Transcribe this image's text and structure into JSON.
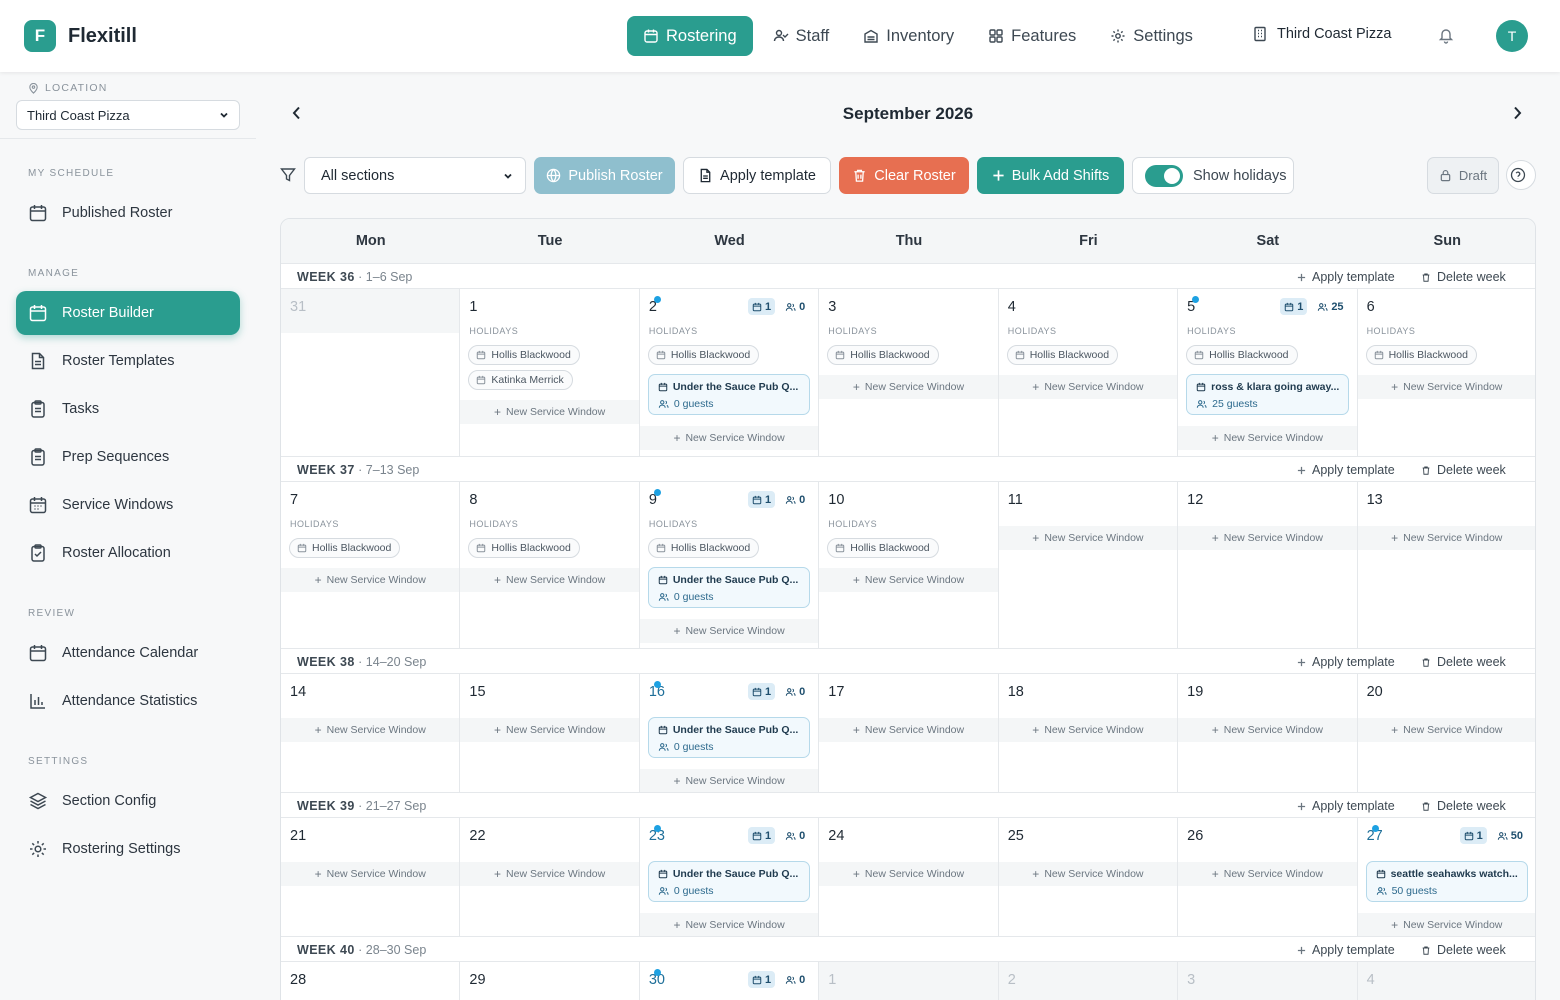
{
  "app": {
    "name": "Flexitill",
    "logo_letter": "F"
  },
  "nav": {
    "items": [
      {
        "label": "Rostering",
        "icon": "calendar-icon",
        "active": true
      },
      {
        "label": "Staff",
        "icon": "staff-icon"
      },
      {
        "label": "Inventory",
        "icon": "inventory-icon"
      },
      {
        "label": "Features",
        "icon": "grid-icon"
      },
      {
        "label": "Settings",
        "icon": "gear-icon"
      }
    ],
    "venue": "Third Coast Pizza",
    "avatar_letter": "T"
  },
  "sidebar": {
    "location_label": "LOCATION",
    "location_value": "Third Coast Pizza",
    "sections": [
      {
        "title": "MY SCHEDULE",
        "items": [
          {
            "label": "Published Roster",
            "icon": "calendar-icon"
          }
        ]
      },
      {
        "title": "MANAGE",
        "items": [
          {
            "label": "Roster Builder",
            "icon": "calendar-icon",
            "active": true
          },
          {
            "label": "Roster Templates",
            "icon": "document-icon"
          },
          {
            "label": "Tasks",
            "icon": "clipboard-icon"
          },
          {
            "label": "Prep Sequences",
            "icon": "clipboard-icon"
          },
          {
            "label": "Service Windows",
            "icon": "calendar-grid-icon"
          },
          {
            "label": "Roster Allocation",
            "icon": "clipboard-check-icon"
          }
        ]
      },
      {
        "title": "REVIEW",
        "items": [
          {
            "label": "Attendance Calendar",
            "icon": "calendar-icon"
          },
          {
            "label": "Attendance Statistics",
            "icon": "bar-chart-icon"
          }
        ]
      },
      {
        "title": "SETTINGS",
        "items": [
          {
            "label": "Section Config",
            "icon": "layers-icon"
          },
          {
            "label": "Rostering Settings",
            "icon": "gear-icon"
          }
        ]
      }
    ]
  },
  "month": {
    "title": "September 2026"
  },
  "toolbar": {
    "section_select": "All sections",
    "publish": "Publish Roster",
    "apply_template": "Apply template",
    "clear": "Clear Roster",
    "bulk_add": "Bulk Add Shifts",
    "show_holidays": "Show holidays",
    "status": "Draft"
  },
  "calendar": {
    "weekdays": [
      "Mon",
      "Tue",
      "Wed",
      "Thu",
      "Fri",
      "Sat",
      "Sun"
    ],
    "holidays_label": "HOLIDAYS",
    "new_service_window": "New Service Window",
    "apply_template": "Apply template",
    "delete_week": "Delete week",
    "weeks": [
      {
        "label": "WEEK 36",
        "range": "1–6 Sep",
        "days": [
          {
            "n": "31",
            "outside": true
          },
          {
            "n": "1",
            "holidays": [
              "Hollis Blackwood",
              "Katinka Merrick"
            ]
          },
          {
            "n": "2",
            "dot": true,
            "badge_windows": "1",
            "badge_staff": "0",
            "holidays": [
              "Hollis Blackwood"
            ],
            "windows": [
              {
                "title": "Under the Sauce Pub Q...",
                "guests": "0 guests"
              }
            ]
          },
          {
            "n": "3",
            "holidays": [
              "Hollis Blackwood"
            ]
          },
          {
            "n": "4",
            "holidays": [
              "Hollis Blackwood"
            ]
          },
          {
            "n": "5",
            "dot": true,
            "badge_windows": "1",
            "badge_staff": "25",
            "holidays": [
              "Hollis Blackwood"
            ],
            "windows": [
              {
                "title": "ross & klara going away...",
                "guests": "25 guests"
              }
            ]
          },
          {
            "n": "6",
            "holidays": [
              "Hollis Blackwood"
            ]
          }
        ]
      },
      {
        "label": "WEEK 37",
        "range": "7–13 Sep",
        "days": [
          {
            "n": "7",
            "holidays": [
              "Hollis Blackwood"
            ]
          },
          {
            "n": "8",
            "holidays": [
              "Hollis Blackwood"
            ]
          },
          {
            "n": "9",
            "dot": true,
            "badge_windows": "1",
            "badge_staff": "0",
            "holidays": [
              "Hollis Blackwood"
            ],
            "windows": [
              {
                "title": "Under the Sauce Pub Q...",
                "guests": "0 guests"
              }
            ]
          },
          {
            "n": "10",
            "holidays": [
              "Hollis Blackwood"
            ]
          },
          {
            "n": "11"
          },
          {
            "n": "12"
          },
          {
            "n": "13"
          }
        ]
      },
      {
        "label": "WEEK 38",
        "range": "14–20 Sep",
        "days": [
          {
            "n": "14"
          },
          {
            "n": "15"
          },
          {
            "n": "16",
            "dot": true,
            "blue": true,
            "badge_windows": "1",
            "badge_staff": "0",
            "windows": [
              {
                "title": "Under the Sauce Pub Q...",
                "guests": "0 guests"
              }
            ]
          },
          {
            "n": "17"
          },
          {
            "n": "18"
          },
          {
            "n": "19"
          },
          {
            "n": "20"
          }
        ]
      },
      {
        "label": "WEEK 39",
        "range": "21–27 Sep",
        "days": [
          {
            "n": "21"
          },
          {
            "n": "22"
          },
          {
            "n": "23",
            "dot": true,
            "blue": true,
            "badge_windows": "1",
            "badge_staff": "0",
            "windows": [
              {
                "title": "Under the Sauce Pub Q...",
                "guests": "0 guests"
              }
            ]
          },
          {
            "n": "24"
          },
          {
            "n": "25"
          },
          {
            "n": "26"
          },
          {
            "n": "27",
            "dot": true,
            "blue": true,
            "badge_windows": "1",
            "badge_staff": "50",
            "windows": [
              {
                "title": "seattle seahawks watch...",
                "guests": "50 guests"
              }
            ]
          }
        ]
      },
      {
        "label": "WEEK 40",
        "range": "28–30 Sep",
        "days": [
          {
            "n": "28"
          },
          {
            "n": "29"
          },
          {
            "n": "30",
            "dot": true,
            "blue": true,
            "badge_windows": "1",
            "badge_staff": "0"
          },
          {
            "n": "1",
            "outside": true
          },
          {
            "n": "2",
            "outside": true
          },
          {
            "n": "3",
            "outside": true
          },
          {
            "n": "4",
            "outside": true
          }
        ]
      }
    ]
  }
}
